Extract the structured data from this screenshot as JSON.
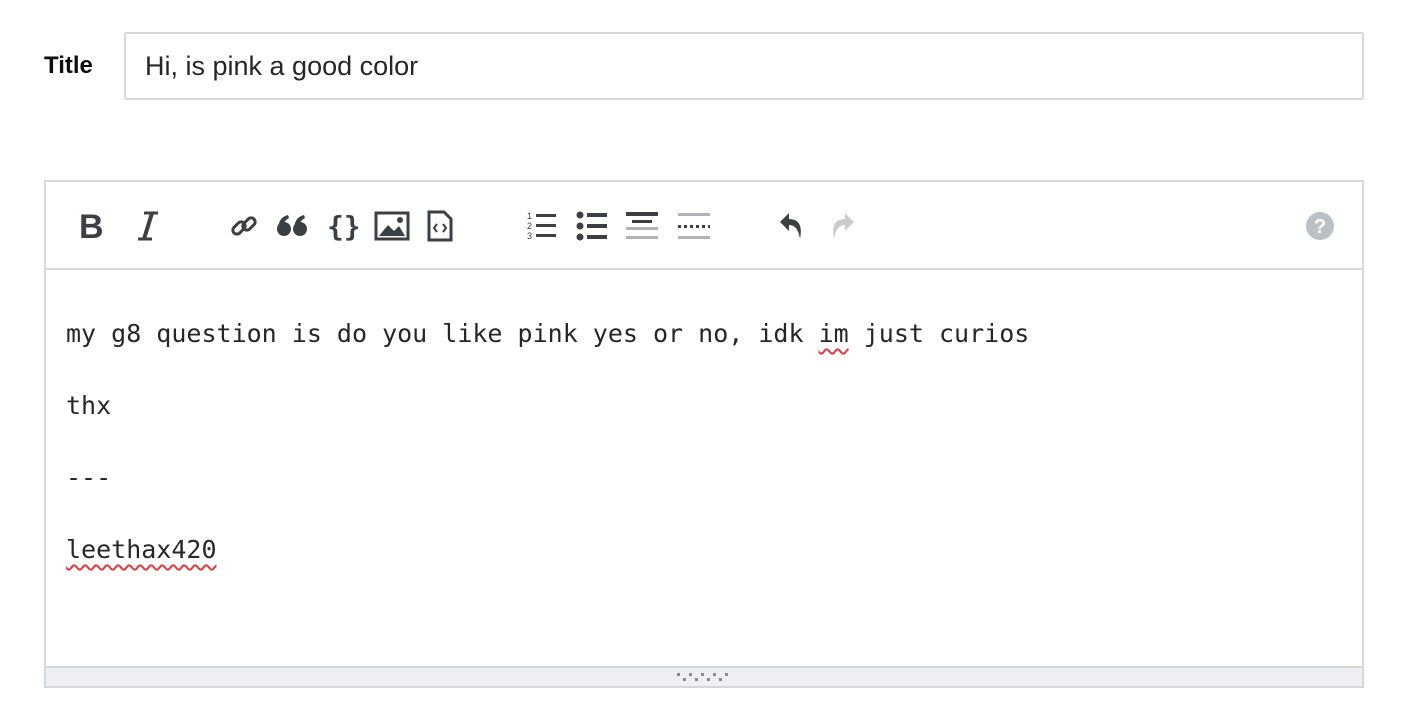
{
  "title_field": {
    "label": "Title",
    "value": "Hi, is pink a good color"
  },
  "toolbar": {
    "buttons": [
      {
        "name": "bold",
        "icon": "bold-icon"
      },
      {
        "name": "italic",
        "icon": "italic-icon"
      },
      {
        "name": "link",
        "icon": "link-icon"
      },
      {
        "name": "blockquote",
        "icon": "quote-icon"
      },
      {
        "name": "code",
        "icon": "code-braces-icon"
      },
      {
        "name": "image",
        "icon": "image-icon"
      },
      {
        "name": "snippet",
        "icon": "snippet-icon"
      },
      {
        "name": "numbered-list",
        "icon": "ordered-list-icon"
      },
      {
        "name": "bulleted-list",
        "icon": "bulleted-list-icon"
      },
      {
        "name": "heading",
        "icon": "heading-icon"
      },
      {
        "name": "horizontal-rule",
        "icon": "horizontal-rule-icon"
      },
      {
        "name": "undo",
        "icon": "undo-icon"
      },
      {
        "name": "redo",
        "icon": "redo-icon",
        "disabled": true
      },
      {
        "name": "help",
        "icon": "help-icon"
      }
    ]
  },
  "body": {
    "line1_a": "my g8 question is do you like pink yes or no, idk ",
    "line1_b": "im",
    "line1_c": " just curios",
    "line2": "thx",
    "line3": "---",
    "line4": "leethax420"
  },
  "colors": {
    "border": "#d6d9dc",
    "icon": "#3b4045",
    "icon_disabled": "#c8ccd0",
    "spellcheck": "#e0393e"
  }
}
